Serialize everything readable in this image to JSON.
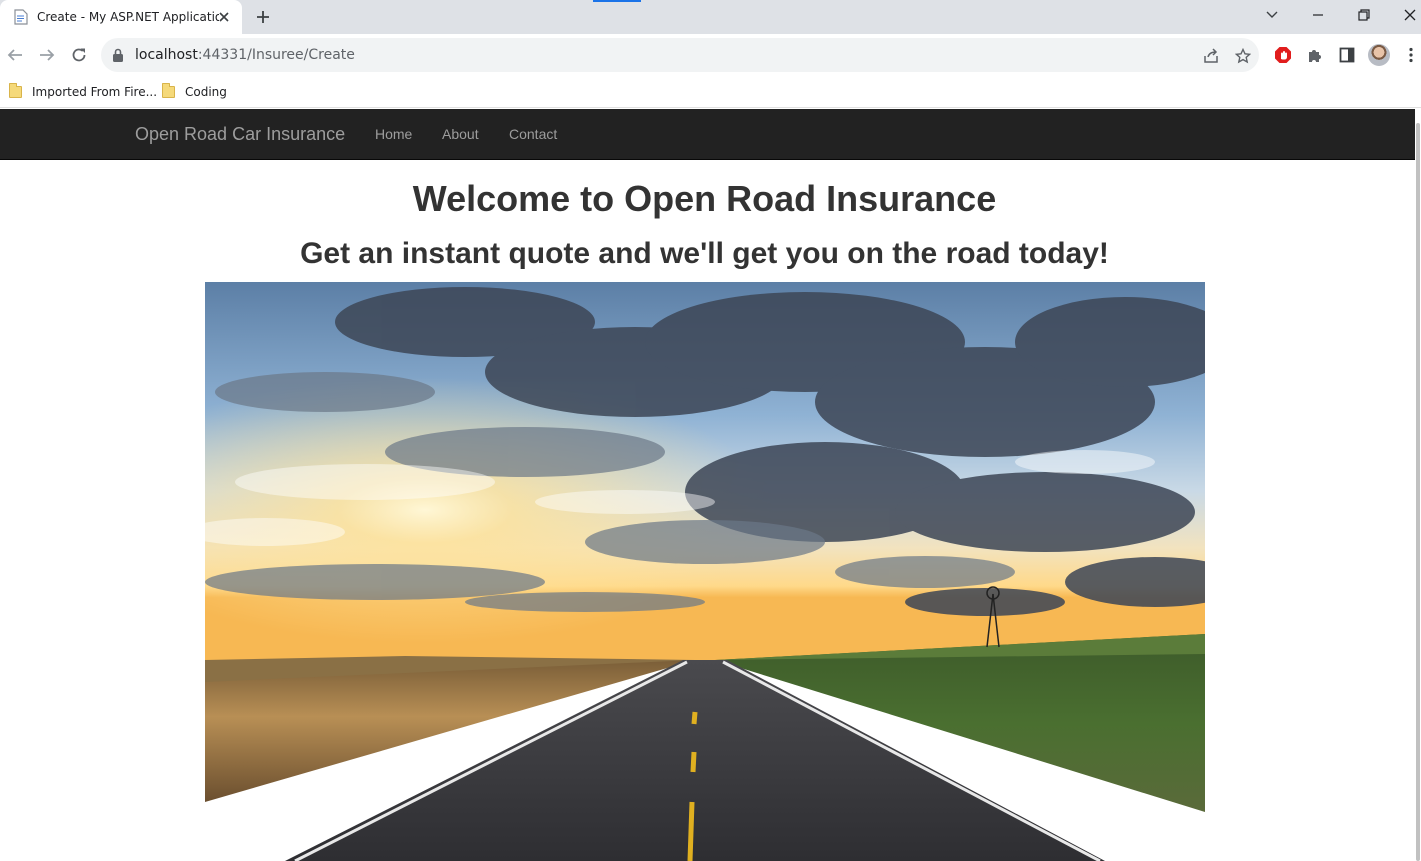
{
  "browser": {
    "tab": {
      "title": "Create - My ASP.NET Application"
    },
    "address": {
      "host": "localhost",
      "port_path": ":44331/Insuree/Create"
    },
    "bookmarks": [
      {
        "label": "Imported From Fire..."
      },
      {
        "label": "Coding"
      }
    ],
    "icons": {
      "tab_favicon": "page-icon",
      "tab_close": "close-icon",
      "new_tab": "plus-icon",
      "tab_search": "chevron-down-icon",
      "minimize": "minimize-icon",
      "restore": "restore-icon",
      "close_window": "close-icon",
      "back": "back-arrow-icon",
      "forward": "forward-arrow-icon",
      "reload": "reload-icon",
      "lock": "lock-icon",
      "share": "share-icon",
      "bookmark": "star-icon",
      "adblock": "adblock-icon",
      "extensions": "puzzle-icon",
      "side_panel": "side-panel-icon",
      "profile": "avatar",
      "menu": "kebab-menu-icon"
    }
  },
  "site": {
    "brand": "Open Road Car Insurance",
    "nav": [
      {
        "label": "Home"
      },
      {
        "label": "About"
      },
      {
        "label": "Contact"
      }
    ],
    "heading": "Welcome to Open Road Insurance",
    "subheading": "Get an instant quote and we'll get you on the road today!",
    "hero_image": {
      "subject": "open-road-sunset-photo"
    }
  },
  "colors": {
    "navbar_bg": "#222222",
    "navbar_text": "#9d9d9d",
    "heading_text": "#333333",
    "chrome_bg": "#dee1e6",
    "accent": "#1a73e8"
  }
}
